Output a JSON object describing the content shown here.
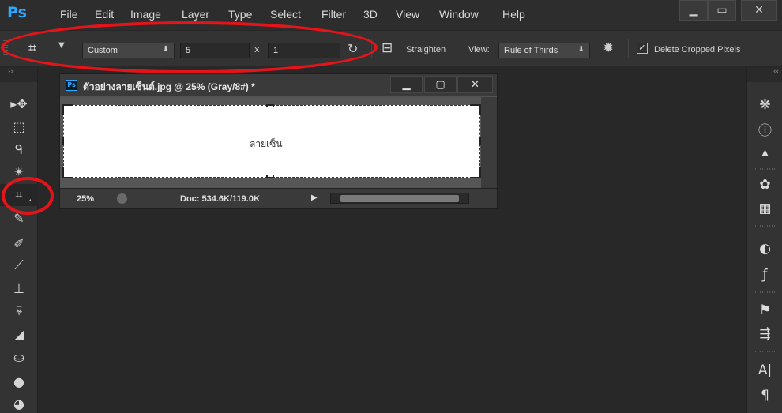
{
  "app": {
    "logo": "Ps",
    "menu": [
      "File",
      "Edit",
      "Image",
      "Layer",
      "Type",
      "Select",
      "Filter",
      "3D",
      "View",
      "Window",
      "Help"
    ],
    "window_controls": {
      "minimize": "▁",
      "maximize": "▭",
      "close": "✕"
    }
  },
  "options_bar": {
    "ratio_preset": "Custom",
    "ratio_width": "5",
    "ratio_separator": "x",
    "ratio_height": "1",
    "straighten_label": "Straighten",
    "view_label": "View:",
    "overlay_option": "Rule of Thirds",
    "delete_cropped_label": "Delete Cropped Pixels",
    "delete_cropped_checked": true
  },
  "left_toolbar": {
    "collapse_label": "››",
    "tools": [
      "move-tool",
      "rectangular-marquee-tool",
      "lasso-tool",
      "magic-wand-tool",
      "crop-tool",
      "eyedropper-tool",
      "spot-healing-brush-tool",
      "brush-tool",
      "clone-stamp-tool",
      "history-brush-tool",
      "eraser-tool",
      "paint-bucket-tool",
      "blur-tool",
      "dodge-tool"
    ],
    "active_tool": "crop-tool"
  },
  "right_toolbar": {
    "collapse_label": "‹‹",
    "panels": [
      "navigator-icon",
      "info-icon",
      "histogram-icon",
      "color-palette-icon",
      "swatches-icon",
      "adjustments-icon",
      "styles-icon",
      "brushes-icon",
      "brush-presets-icon",
      "character-icon",
      "paragraph-icon"
    ]
  },
  "document": {
    "title": "ตัวอย่างลายเซ็นต์.jpg @ 25% (Gray/8#) *",
    "canvas_text": "ลายเซ็น",
    "zoom": "25%",
    "doc_info": "Doc: 534.6K/119.0K",
    "window_controls": {
      "minimize": "▁",
      "maximize": "▢",
      "close": "✕"
    }
  },
  "annotation_color": "#e3141a"
}
